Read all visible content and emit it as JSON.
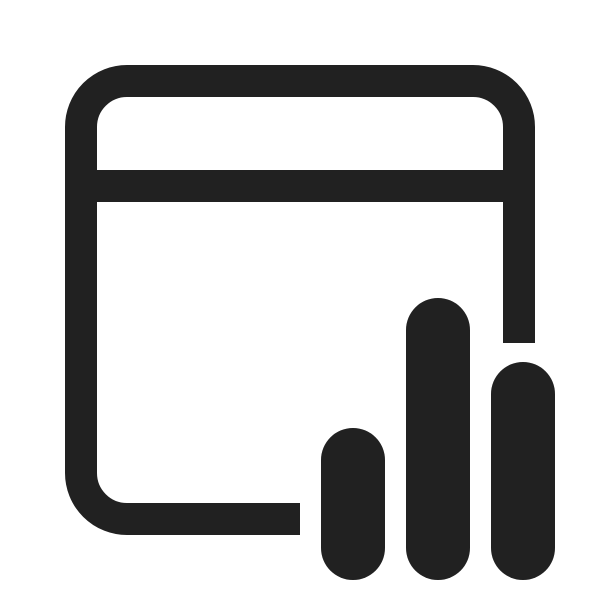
{
  "icon": {
    "name": "window-bar-chart-icon",
    "color": "#212121",
    "background": "#ffffff"
  }
}
